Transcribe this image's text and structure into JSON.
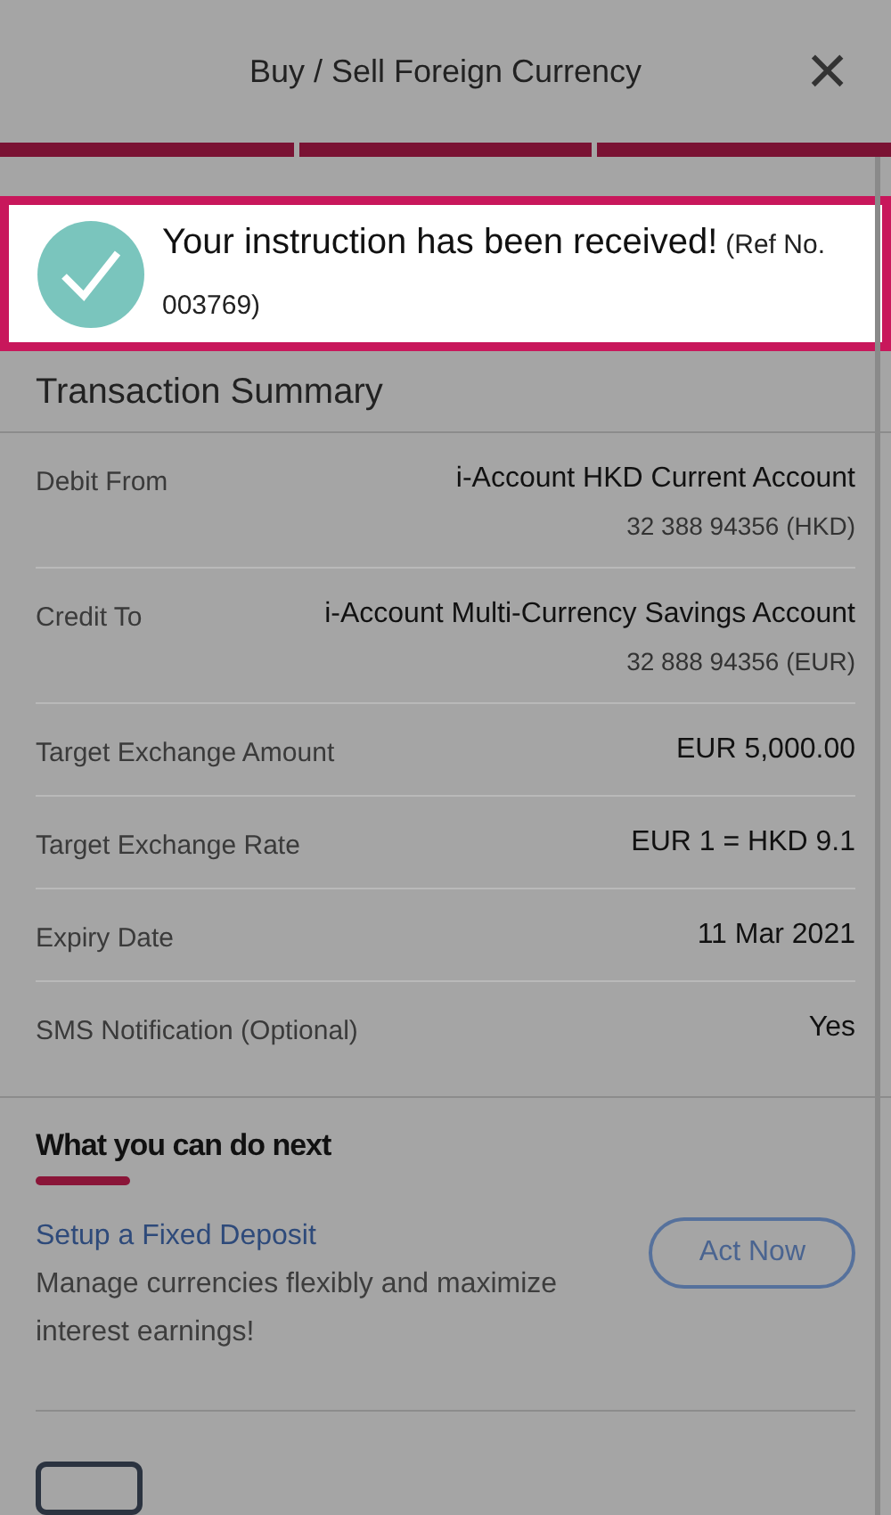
{
  "header": {
    "title": "Buy / Sell Foreign Currency",
    "close": "×"
  },
  "steps": [
    {
      "done": true
    },
    {
      "done": true
    },
    {
      "done": true
    }
  ],
  "banner": {
    "message": "Your instruction has been received!",
    "reference": "(Ref No. 003769)"
  },
  "summary": {
    "title": "Transaction Summary",
    "rows": [
      {
        "label": "Debit From",
        "value": "i-Account HKD Current Account",
        "detail": "32 388 94356 (HKD)"
      },
      {
        "label": "Credit To",
        "value": "i-Account Multi-Currency Savings Account",
        "detail": "32 888 94356 (EUR)"
      },
      {
        "label": "Target Exchange Amount",
        "value": "EUR 5,000.00"
      },
      {
        "label": "Target Exchange Rate",
        "value": "EUR 1 = HKD 9.1"
      },
      {
        "label": "Expiry Date",
        "value": "11 Mar 2021"
      },
      {
        "label": "SMS Notification (Optional)",
        "value": "Yes"
      }
    ]
  },
  "next": {
    "title": "What you can do next",
    "offers": [
      {
        "link": "Setup a Fixed Deposit",
        "description": "Manage currencies flexibly and maximize interest earnings!",
        "button": "Act Now"
      }
    ]
  }
}
